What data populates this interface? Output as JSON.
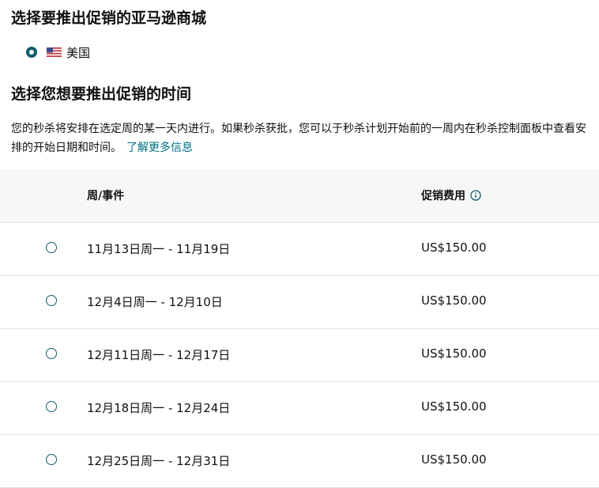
{
  "marketplace_section": {
    "title": "选择要推出促销的亚马逊商城",
    "options": [
      {
        "label": "美国",
        "flag_icon": "us-flag-icon",
        "selected": true
      }
    ]
  },
  "time_section": {
    "title": "选择您想要推出促销的时间",
    "description": "您的秒杀将安排在选定周的某一天内进行。如果秒杀获批，您可以于秒杀计划开始前的一周内在秒杀控制面板中查看安排的开始日期和时间。",
    "learn_more": "了解更多信息"
  },
  "table": {
    "headers": {
      "week": "周/事件",
      "fee": "促销费用",
      "fee_icon": "info-icon"
    },
    "rows": [
      {
        "week": "11月13日周一 - 11月19日",
        "fee": "US$150.00"
      },
      {
        "week": "12月4日周一 - 12月10日",
        "fee": "US$150.00"
      },
      {
        "week": "12月11日周一 - 12月17日",
        "fee": "US$150.00"
      },
      {
        "week": "12月18日周一 - 12月24日",
        "fee": "US$150.00"
      },
      {
        "week": "12月25日周一 - 12月31日",
        "fee": "US$150.00"
      }
    ]
  },
  "colors": {
    "accent": "#0f5d6b",
    "link": "#007185",
    "text": "#0f1111",
    "header_bg": "#f7f7f7",
    "divider": "#e3e6e6"
  }
}
